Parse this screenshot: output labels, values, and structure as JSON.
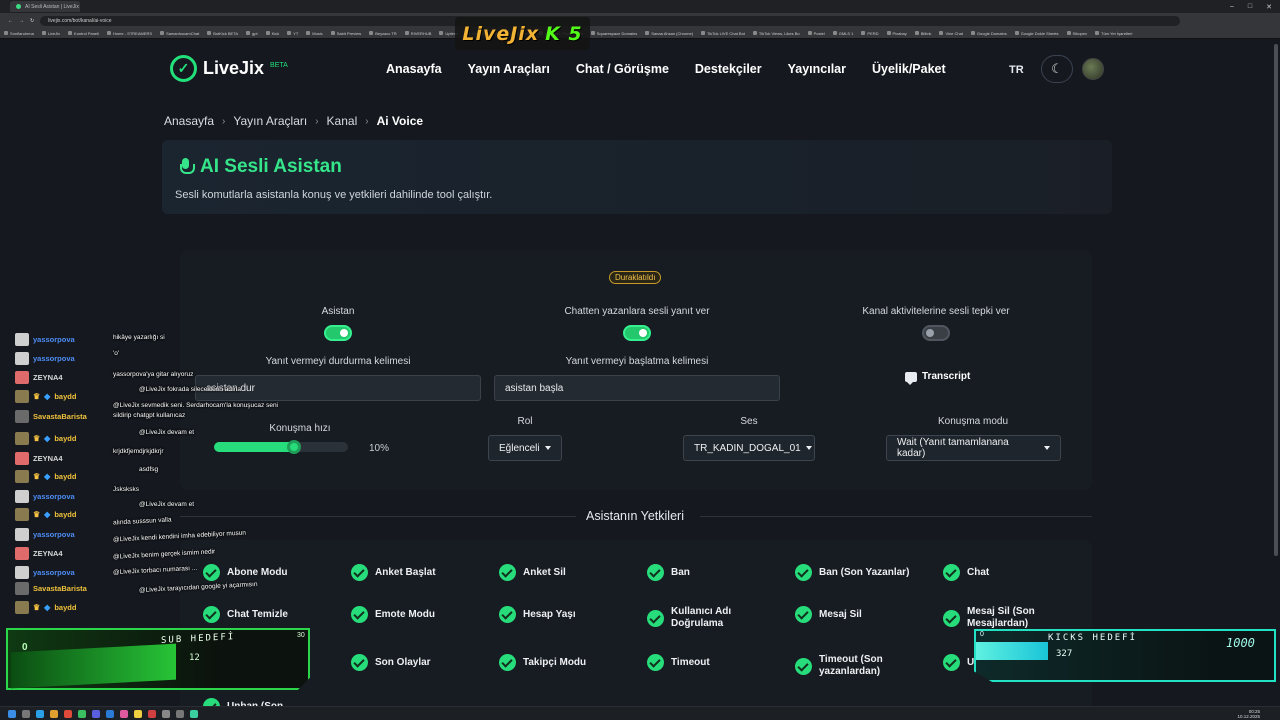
{
  "browser": {
    "tab_title": "AI Sesli Asistan | LiveJix",
    "url": "livejix.com/bot/kanal/ai-voice",
    "bookmarks": [
      "Sınıflandırma",
      "LiveJix",
      "Kontrol Paneli",
      "Home - STREAMERS",
      "SamanhocamChat",
      "BotKick BETA",
      "gpt",
      "Kick",
      "YT",
      "Music",
      "Sabit Preview",
      "Beyzacc TR",
      "RIVERHUB",
      "Uptime",
      "Copy B",
      "Capacitor by Ionic",
      "Connect, Protect and",
      "Squarespace Domains",
      "Sanaa Ahsan (Chrome)",
      "TikTok LIVE Chat Bot",
      "TikTok Views, Likes Bo",
      "Postel",
      "GMLS 1",
      "PERD",
      "Pixabay",
      "Bitlink",
      "Vine Chat",
      "Google Domains",
      "Google Dokle Sheets",
      "Sibopex",
      "Tüm Yer İşaretleri"
    ]
  },
  "stream_logo": {
    "text": "LiveJix",
    "suffix": "K 5"
  },
  "header": {
    "brand": "LiveJix",
    "beta": "BETA",
    "nav": [
      "Anasayfa",
      "Yayın Araçları",
      "Chat / Görüşme",
      "Destekçiler",
      "Yayıncılar",
      "Üyelik/Paket"
    ],
    "lang": "TR"
  },
  "breadcrumb": [
    "Anasayfa",
    "Yayın Araçları",
    "Kanal",
    "Ai Voice"
  ],
  "hero": {
    "title": "AI Sesli Asistan",
    "subtitle": "Sesli komutlarla asistanla konuş ve yetkileri dahilinde tool çalıştır."
  },
  "settings": {
    "status": "Duraklatıldı",
    "toggles": [
      {
        "label": "Asistan",
        "on": true
      },
      {
        "label": "Chatten yazanlara sesli yanıt ver",
        "on": true
      },
      {
        "label": "Kanal aktivitelerine sesli tepki ver",
        "on": false
      }
    ],
    "stop_word_label": "Yanıt vermeyi durdurma kelimesi",
    "stop_word_value": "asistan dur",
    "start_word_label": "Yanıt vermeyi başlatma kelimesi",
    "start_word_value": "asistan başla",
    "transcript_label": "Transcript",
    "speed_label": "Konuşma hızı",
    "speed_value_text": "10%",
    "speed_fraction": 0.6,
    "role_label": "Rol",
    "role_value": "Eğlenceli",
    "voice_label": "Ses",
    "voice_value": "TR_KADIN_DOGAL_01",
    "mode_label": "Konuşma modu",
    "mode_value": "Wait (Yanıt tamamlanana kadar)"
  },
  "permissions": {
    "title": "Asistanın Yetkileri",
    "items": [
      "Abone Modu",
      "Anket Başlat",
      "Anket Sil",
      "Ban",
      "Ban (Son Yazanlar)",
      "Chat",
      "Chat Temizle",
      "Emote Modu",
      "Hesap Yaşı",
      "Kullanıcı Adı Doğrulama",
      "Mesaj Sil",
      "Mesaj Sil (Son Mesajlardan)",
      "",
      "Son Olaylar",
      "Takipçi Modu",
      "Timeout",
      "Timeout (Son yazanlardan)",
      "Unban",
      "Unban (Son"
    ]
  },
  "chat": {
    "users": [
      {
        "name": "yassorpova",
        "color": "#4d8cf5",
        "badges": false
      },
      {
        "name": "yassorpova",
        "color": "#4d8cf5",
        "badges": false
      },
      {
        "name": "ZEYNA4",
        "color": "#d7d7d7",
        "badges": false
      },
      {
        "name": "baydd",
        "color": "#f0c23b",
        "badges": true
      },
      {
        "name": "SavastaBarista",
        "color": "#f0c23b",
        "badges": false
      },
      {
        "name": "baydd",
        "color": "#f0c23b",
        "badges": true
      },
      {
        "name": "ZEYNA4",
        "color": "#d7d7d7",
        "badges": false
      },
      {
        "name": "baydd",
        "color": "#f0c23b",
        "badges": true
      },
      {
        "name": "yassorpova",
        "color": "#4d8cf5",
        "badges": false
      },
      {
        "name": "baydd",
        "color": "#f0c23b",
        "badges": true
      },
      {
        "name": "yassorpova",
        "color": "#4d8cf5",
        "badges": false
      },
      {
        "name": "ZEYNA4",
        "color": "#d7d7d7",
        "badges": false
      },
      {
        "name": "yassorpova",
        "color": "#4d8cf5",
        "badges": false
      },
      {
        "name": "SavastaBarista",
        "color": "#f0c23b",
        "badges": false
      },
      {
        "name": "baydd",
        "color": "#f0c23b",
        "badges": true
      }
    ],
    "messages": [
      "hikâye yazarlığı si",
      "'o'",
      "yassorpova'ya gitar alıyoruz",
      "@LiveJix fokrada sileceklerin adına",
      "@LiveJix sevmedik seni. Serdarhocam'la konuşucaz seni",
      "sildirip chatgpt kullanıcaz",
      "@LiveJix devam et",
      "krjdkfjemdjrkjdkrjr",
      "asdfsg",
      "Jsksksks",
      "@LiveJix devam et",
      "alında susssun valla",
      "@LiveJix kendi kendini imha edebiliyor musun",
      "@LiveJix benim gerçek ismim nedir",
      "@LiveJix torbacı numarası ...",
      "@LiveJix tarayıcıdan google yi açarmısın"
    ]
  },
  "sub_goal": {
    "title": "SUB HEDEFİ",
    "current": "0",
    "count": "12",
    "max": "30"
  },
  "kicks_goal": {
    "title": "KICKS HEDEFİ",
    "zero": "0",
    "current": "327",
    "max": "1000"
  },
  "taskbar": {
    "time": "00:25",
    "date": "10.12.2025"
  }
}
